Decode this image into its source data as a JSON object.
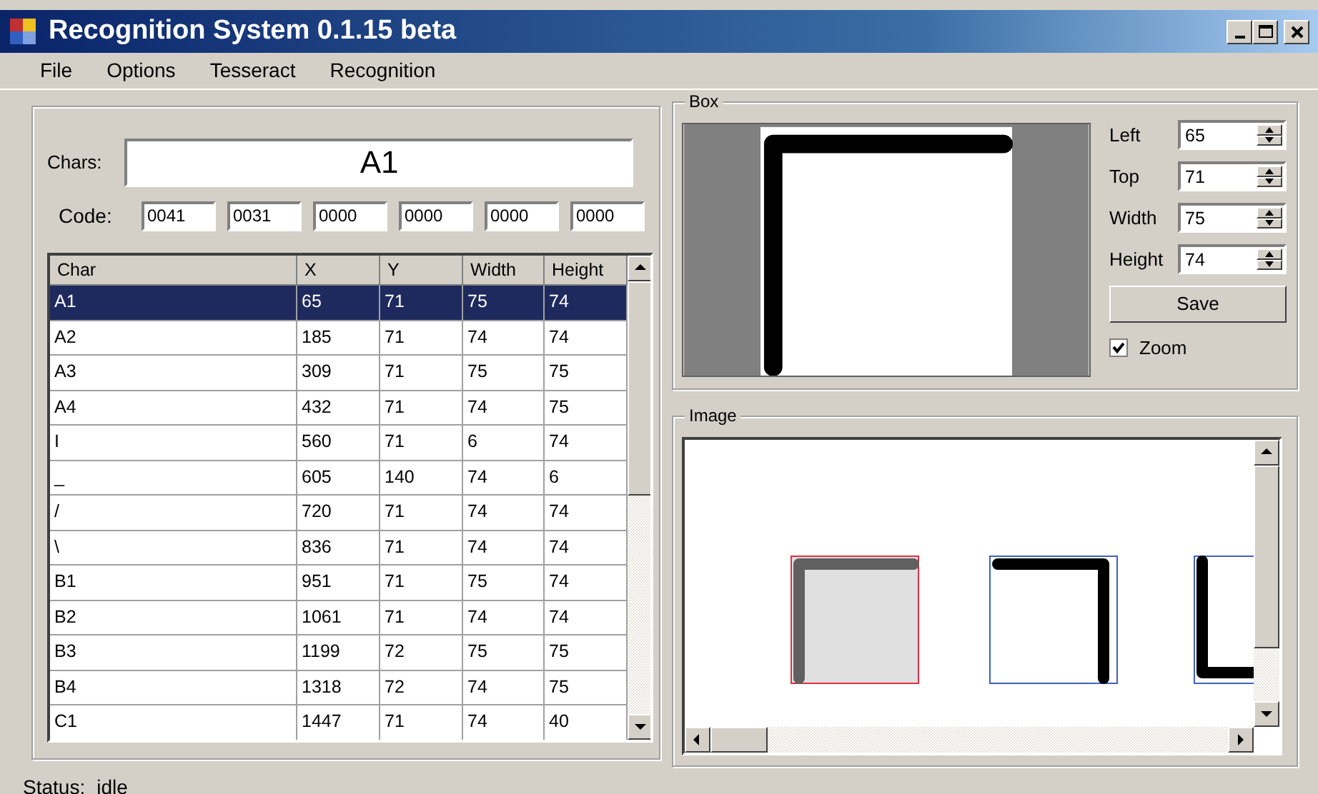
{
  "window": {
    "title": "Recognition System 0.1.15 beta"
  },
  "menu": [
    "File",
    "Options",
    "Tesseract",
    "Recognition"
  ],
  "chars": {
    "label": "Chars:",
    "value": "A1"
  },
  "code": {
    "label": "Code:",
    "values": [
      "0041",
      "0031",
      "0000",
      "0000",
      "0000",
      "0000"
    ]
  },
  "table": {
    "columns": [
      "Char",
      "X",
      "Y",
      "Width",
      "Height"
    ],
    "rows": [
      {
        "cells": [
          "A1",
          "65",
          "71",
          "75",
          "74"
        ],
        "selected": true
      },
      {
        "cells": [
          "A2",
          "185",
          "71",
          "74",
          "74"
        ],
        "selected": false
      },
      {
        "cells": [
          "A3",
          "309",
          "71",
          "75",
          "75"
        ],
        "selected": false
      },
      {
        "cells": [
          "A4",
          "432",
          "71",
          "74",
          "75"
        ],
        "selected": false
      },
      {
        "cells": [
          "I",
          "560",
          "71",
          "6",
          "74"
        ],
        "selected": false
      },
      {
        "cells": [
          "_",
          "605",
          "140",
          "74",
          "6"
        ],
        "selected": false
      },
      {
        "cells": [
          "/",
          "720",
          "71",
          "74",
          "74"
        ],
        "selected": false
      },
      {
        "cells": [
          "\\",
          "836",
          "71",
          "74",
          "74"
        ],
        "selected": false
      },
      {
        "cells": [
          "B1",
          "951",
          "71",
          "75",
          "74"
        ],
        "selected": false
      },
      {
        "cells": [
          "B2",
          "1061",
          "71",
          "74",
          "74"
        ],
        "selected": false
      },
      {
        "cells": [
          "B3",
          "1199",
          "72",
          "75",
          "75"
        ],
        "selected": false
      },
      {
        "cells": [
          "B4",
          "1318",
          "72",
          "74",
          "75"
        ],
        "selected": false
      },
      {
        "cells": [
          "C1",
          "1447",
          "71",
          "74",
          "40"
        ],
        "selected": false
      }
    ]
  },
  "box": {
    "title": "Box",
    "fields": [
      {
        "label": "Left",
        "value": "65"
      },
      {
        "label": "Top",
        "value": "71"
      },
      {
        "label": "Width",
        "value": "75"
      },
      {
        "label": "Height",
        "value": "74"
      }
    ],
    "save": "Save",
    "zoom": {
      "label": "Zoom",
      "checked": true
    }
  },
  "image": {
    "title": "Image",
    "glyphs": [
      {
        "selected": true
      },
      {
        "selected": false
      },
      {
        "selected": false
      }
    ]
  },
  "status": {
    "label": "Status:",
    "value": "idle"
  }
}
